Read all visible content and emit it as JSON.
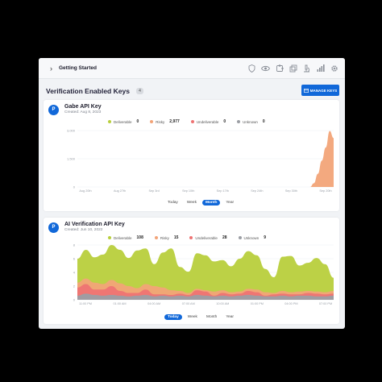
{
  "topbar": {
    "title": "Getting Started",
    "icons": [
      "shield-icon",
      "eye-icon",
      "puzzle-icon",
      "layers-icon",
      "microscope-icon",
      "signal-icon",
      "settings-icon"
    ]
  },
  "section": {
    "title": "Verification Enabled Keys",
    "count": "4",
    "manage_label": "MANAGE KEYS"
  },
  "colors": {
    "deliverable": "#b8cf3c",
    "risky": "#f2a478",
    "undeliverable": "#ee7373",
    "unknown": "#9b9ea4",
    "accent": "#1168d9"
  },
  "keys": [
    {
      "avatar": "P",
      "name": "Gabe API Key",
      "created": "Created: Aug 8, 2023",
      "legend": [
        {
          "label": "Deliverable",
          "value": "0"
        },
        {
          "label": "Risky",
          "value": "2,977"
        },
        {
          "label": "Undeliverable",
          "value": "0"
        },
        {
          "label": "Unknown",
          "value": "0"
        }
      ],
      "tabs": [
        "Today",
        "Week",
        "Month",
        "Year"
      ],
      "active_tab": "Month"
    },
    {
      "avatar": "P",
      "name": "AI Verification API Key",
      "created": "Created: Jun 10, 2022",
      "legend": [
        {
          "label": "Deliverable",
          "value": "108"
        },
        {
          "label": "Risky",
          "value": "15"
        },
        {
          "label": "Undeliverable",
          "value": "28"
        },
        {
          "label": "Unknown",
          "value": "9"
        }
      ],
      "tabs": [
        "Today",
        "Week",
        "Month",
        "Year"
      ],
      "active_tab": "Today"
    }
  ],
  "chart_data": [
    {
      "type": "area",
      "y_ticks": [
        "3,000",
        "1,500",
        "0"
      ],
      "x_ticks": [
        "Aug 20th",
        "Aug 27th",
        "Sep 3rd",
        "Sep 10th",
        "Sep 17th",
        "Sep 24th",
        "Sep 30th",
        "Sep 20th"
      ],
      "ylim": [
        0,
        3000
      ],
      "grid": true,
      "series": [
        {
          "name": "Risky",
          "values": [
            0,
            0,
            0,
            0,
            0,
            0,
            0,
            0,
            0,
            0,
            0,
            0,
            0,
            0,
            0,
            0,
            0,
            0,
            0,
            0,
            0,
            0,
            0,
            0,
            0,
            0,
            0,
            0,
            0,
            0,
            0,
            0,
            0,
            0,
            0,
            0,
            0,
            0,
            0,
            0,
            0,
            0,
            0,
            0,
            0,
            0,
            0,
            0,
            0,
            0,
            0,
            0,
            0,
            0,
            0,
            0,
            0,
            0,
            0,
            0,
            200,
            700,
            1400,
            2100,
            2977,
            2600
          ]
        }
      ]
    },
    {
      "type": "area",
      "y_ticks": [
        "8",
        "6",
        "4",
        "2",
        "0"
      ],
      "x_ticks": [
        "11:00 PM",
        "01:00 AM",
        "04:00 AM",
        "07:00 AM",
        "10:00 AM",
        "01:00 PM",
        "04:00 PM",
        "07:00 PM"
      ],
      "ylim": [
        0,
        8
      ],
      "grid": true,
      "series": [
        {
          "name": "Deliverable",
          "values": [
            6,
            7.3,
            6.2,
            6.6,
            8.2,
            7.3,
            6.1,
            7.2,
            7.5,
            5.2,
            6.9,
            7.5,
            4.8,
            4.1,
            6.8,
            6.5,
            5.6,
            5.8,
            4.9,
            6.0,
            7.1,
            6.5,
            4.5,
            3.3,
            6.3,
            6.4,
            5.0,
            5.4,
            6.1,
            5.2,
            3.2
          ]
        },
        {
          "name": "Risky",
          "values": [
            2.5,
            3.1,
            2.5,
            2.3,
            2.9,
            2.4,
            2.0,
            1.7,
            2.3,
            2.0,
            1.8,
            1.4,
            1.3,
            1.0,
            1.6,
            1.4,
            1.2,
            1.4,
            1.1,
            1.2,
            1.6,
            1.5,
            1.1,
            1.0,
            1.3,
            1.1,
            1.2,
            1.3,
            1.2,
            1.1,
            1.3
          ]
        },
        {
          "name": "Undeliverable",
          "values": [
            1.8,
            2.3,
            1.5,
            1.5,
            2.0,
            1.3,
            1.0,
            1.0,
            1.5,
            0.8,
            0.8,
            0.7,
            0.9,
            0.7,
            1.4,
            1.2,
            0.6,
            1.0,
            0.8,
            0.9,
            1.3,
            1.1,
            0.6,
            0.8,
            0.9,
            0.8,
            0.8,
            1.0,
            0.9,
            0.8,
            0.9
          ]
        },
        {
          "name": "Unknown",
          "values": [
            0.6,
            0.9,
            0.7,
            0.6,
            0.7,
            0.6,
            0.5,
            0.6,
            0.7,
            0.5,
            0.6,
            0.5,
            0.6,
            0.5,
            0.7,
            0.6,
            0.5,
            0.6,
            0.5,
            0.6,
            0.7,
            0.6,
            0.5,
            0.5,
            0.6,
            0.5,
            0.6,
            0.6,
            0.5,
            0.5,
            0.6
          ]
        }
      ]
    }
  ]
}
